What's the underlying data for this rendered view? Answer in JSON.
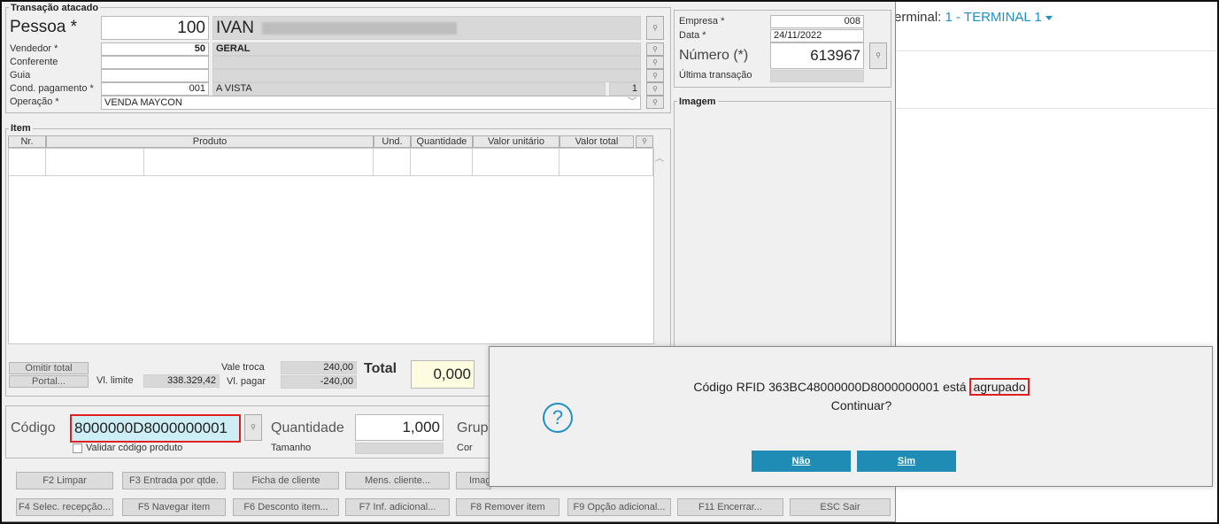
{
  "background": {
    "terminal_label": "erminal:",
    "terminal_value": "1 - TERMINAL 1"
  },
  "transacao": {
    "group_title": "Transação atacado",
    "pessoa_label": "Pessoa *",
    "pessoa_code": "100",
    "pessoa_name": "IVAN",
    "vendedor_label": "Vendedor *",
    "vendedor_code": "50",
    "vendedor_name": "GERAL",
    "conferente_label": "Conferente",
    "guia_label": "Guia",
    "cond_label": "Cond. pagamento *",
    "cond_code": "001",
    "cond_name": "A VISTA",
    "cond_count": "1",
    "operacao_label": "Operação *",
    "operacao_value": "VENDA MAYCON"
  },
  "empresa": {
    "empresa_label": "Empresa *",
    "empresa_value": "008",
    "data_label": "Data *",
    "data_value": "24/11/2022",
    "numero_label": "Número (*)",
    "numero_value": "613967",
    "ultima_label": "Última transação",
    "imagem_title": "Imagem"
  },
  "item": {
    "group_title": "Item",
    "columns": [
      "Nr.",
      "Produto",
      "Und.",
      "Quantidade",
      "Valor unitário",
      "Valor total"
    ]
  },
  "totals": {
    "omitir_total": "Omitir total",
    "portal": "Portal...",
    "vl_limite_label": "Vl. limite",
    "vl_limite_value": "338.329,42",
    "vale_troca_label": "Vale troca",
    "vale_troca_value": "240,00",
    "vl_pagar_label": "Vl. pagar",
    "vl_pagar_value": "-240,00",
    "total_label": "Total",
    "total_value": "0,000"
  },
  "codigo": {
    "codigo_label": "Código",
    "codigo_value": "8000000D8000000001",
    "validar_label": "Validar código produto",
    "quantidade_label": "Quantidade",
    "quantidade_value": "1,000",
    "tamanho_label": "Tamanho",
    "grupo_label": "Grup",
    "cor_label": "Cor"
  },
  "function_keys": {
    "row1": [
      "F2 Limpar",
      "F3 Entrada por qtde.",
      "Ficha de cliente",
      "Mens. cliente...",
      "Imag"
    ],
    "row2": [
      "F4 Selec. recepção...",
      "F5 Navegar item",
      "F6 Desconto item...",
      "F7 Inf. adicional...",
      "F8 Remover item",
      "F9 Opção adicional...",
      "F11 Encerrar...",
      "ESC Sair"
    ]
  },
  "dialog": {
    "message_prefix": "Código RFID 363BC48000000D8000000001 está ",
    "message_highlight": "agrupado",
    "message_line2": "Continuar?",
    "question_icon": "?",
    "nao_label": "Não",
    "sim_label": "Sim"
  },
  "colors": {
    "accent": "#1f8fc7",
    "dialog_button": "#1e8cb4",
    "highlight_border": "#e02020",
    "codigo_bg": "#cdeef5"
  }
}
